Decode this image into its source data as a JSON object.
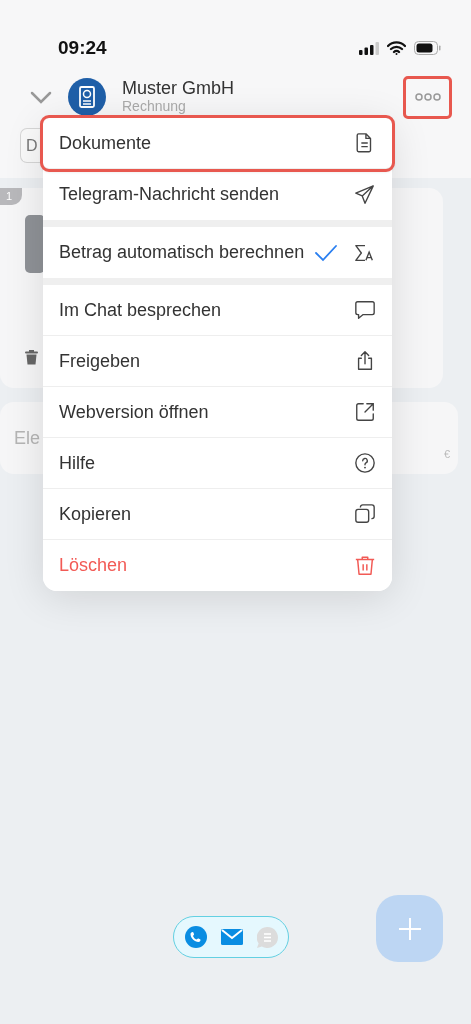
{
  "status_bar": {
    "time": "09:24"
  },
  "header": {
    "title": "Muster GmbH",
    "subtitle": "Rechnung",
    "more_button": {
      "highlighted": true
    }
  },
  "background": {
    "tab_button": "D",
    "card": {
      "badge": "1"
    },
    "amount_field": {
      "placeholder": "Ele",
      "currency": "€"
    }
  },
  "menu": {
    "sections": [
      {
        "items": [
          {
            "label": "Dokumente",
            "highlighted": true,
            "checked": false,
            "destructive": false
          },
          {
            "label": "Telegram-Nachricht senden",
            "highlighted": false,
            "checked": false,
            "destructive": false
          }
        ]
      },
      {
        "items": [
          {
            "label": "Betrag automatisch berechnen",
            "highlighted": false,
            "checked": true,
            "destructive": false
          }
        ]
      },
      {
        "items": [
          {
            "label": "Im Chat besprechen",
            "highlighted": false,
            "checked": false,
            "destructive": false
          },
          {
            "label": "Freigeben",
            "highlighted": false,
            "checked": false,
            "destructive": false
          },
          {
            "label": "Webversion öffnen",
            "highlighted": false,
            "checked": false,
            "destructive": false
          },
          {
            "label": "Hilfe",
            "highlighted": false,
            "checked": false,
            "destructive": false
          },
          {
            "label": "Kopieren",
            "highlighted": false,
            "checked": false,
            "destructive": false
          },
          {
            "label": "Löschen",
            "highlighted": false,
            "checked": false,
            "destructive": true
          }
        ]
      }
    ]
  }
}
